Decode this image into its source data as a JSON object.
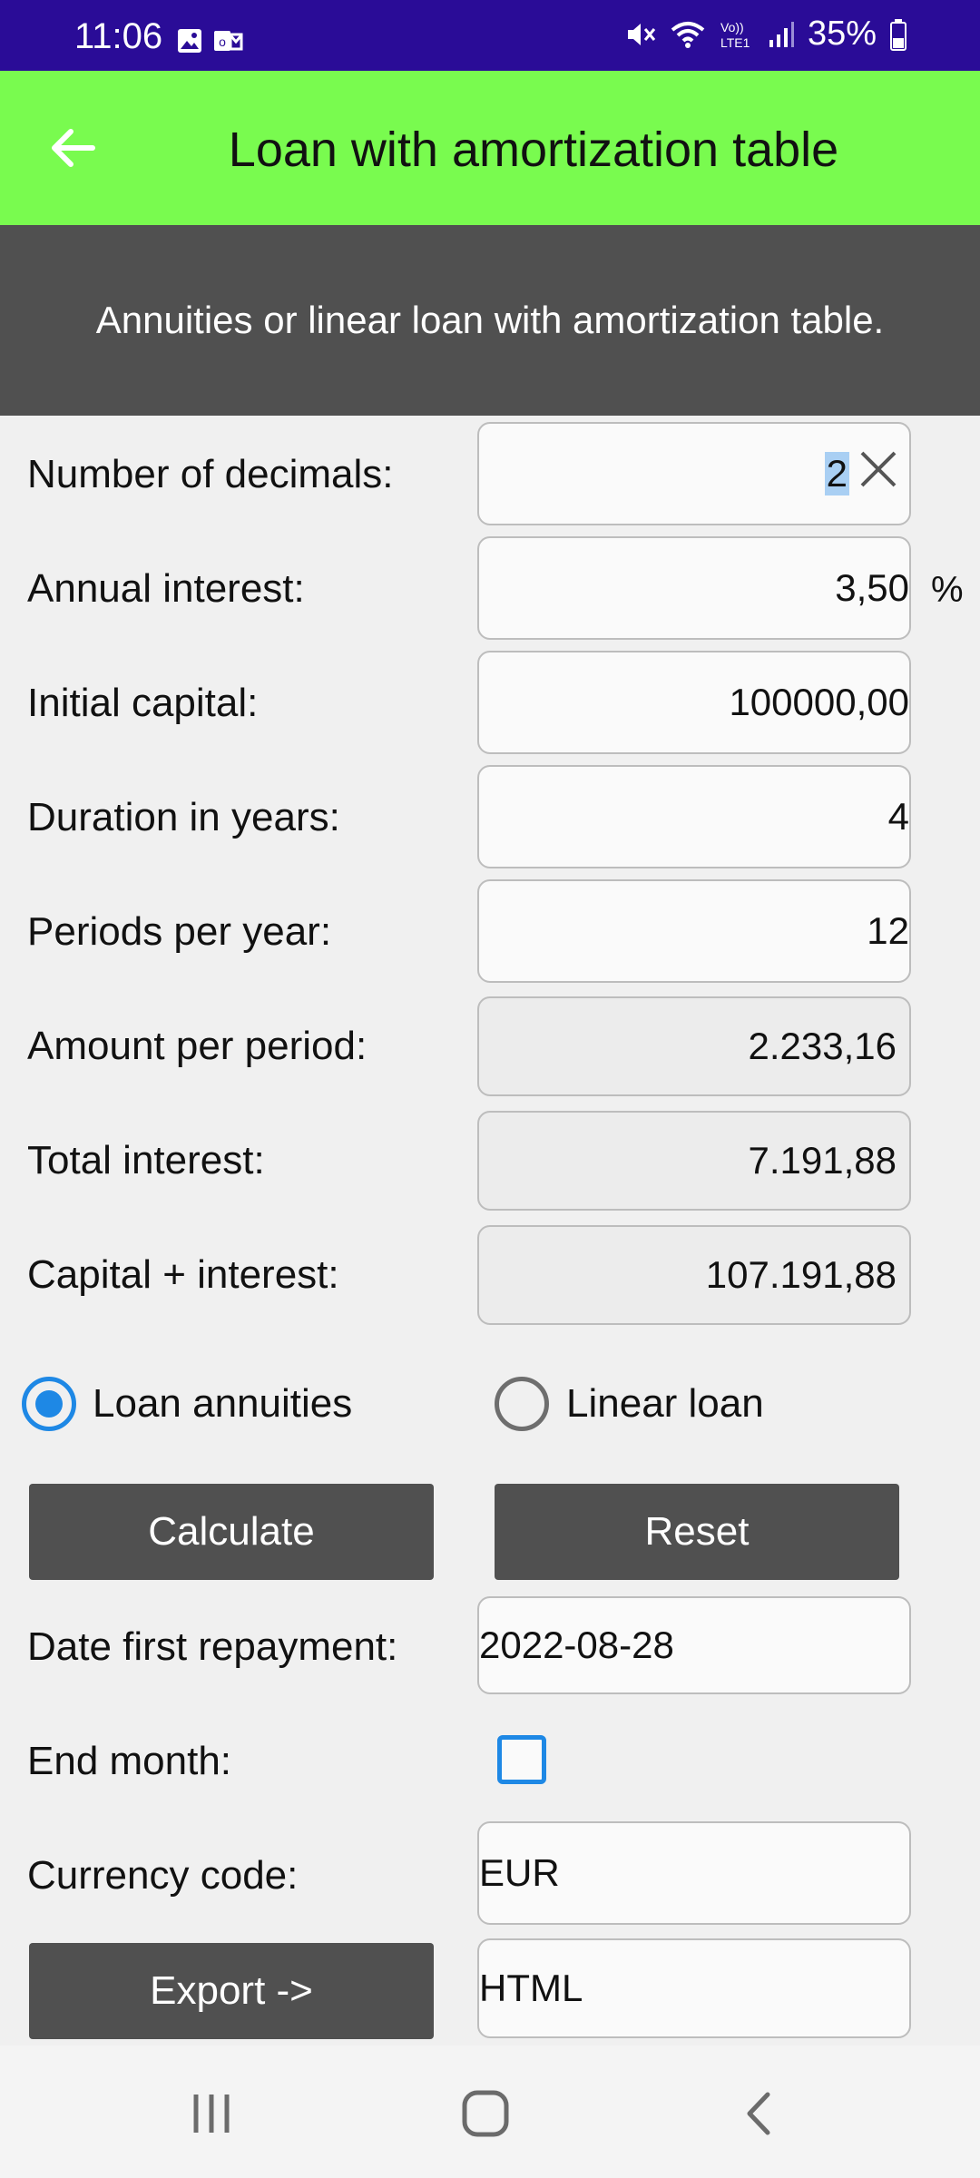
{
  "status_bar": {
    "time": "11:06",
    "battery": "35%",
    "icons": [
      "gallery-icon",
      "outlook-icon",
      "mute-icon",
      "wifi-icon",
      "volte-icon",
      "signal-icon",
      "battery-icon"
    ]
  },
  "app_bar": {
    "title": "Loan with amortization table",
    "background": "#79fb4f"
  },
  "banner": {
    "text": "Annuities or linear loan with amortization table."
  },
  "form": {
    "decimals_label": "Number of decimals:",
    "decimals_value": "2",
    "interest_label": "Annual interest:",
    "interest_value": "3,50",
    "interest_unit": "%",
    "capital_label": "Initial capital:",
    "capital_value": "100000,00",
    "duration_label": "Duration in years:",
    "duration_value": "4",
    "periods_label": "Periods per year:",
    "periods_value": "12",
    "amount_label": "Amount per period:",
    "amount_value": "2.233,16",
    "total_interest_label": "Total interest:",
    "total_interest_value": "7.191,88",
    "capital_interest_label": "Capital + interest:",
    "capital_interest_value": "107.191,88"
  },
  "loan_type": {
    "annuities_label": "Loan annuities",
    "linear_label": "Linear loan",
    "selected": "annuities"
  },
  "buttons": {
    "calculate": "Calculate",
    "reset": "Reset",
    "export": "Export ->"
  },
  "extra": {
    "date_label": "Date first repayment:",
    "date_value": "2022-08-28",
    "end_month_label": "End month:",
    "end_month_checked": false,
    "currency_label": "Currency code:",
    "currency_value": "EUR",
    "export_format": "HTML"
  },
  "colors": {
    "status_bar": "#2a0c97",
    "accent": "#1e88e5",
    "button": "#505050"
  }
}
